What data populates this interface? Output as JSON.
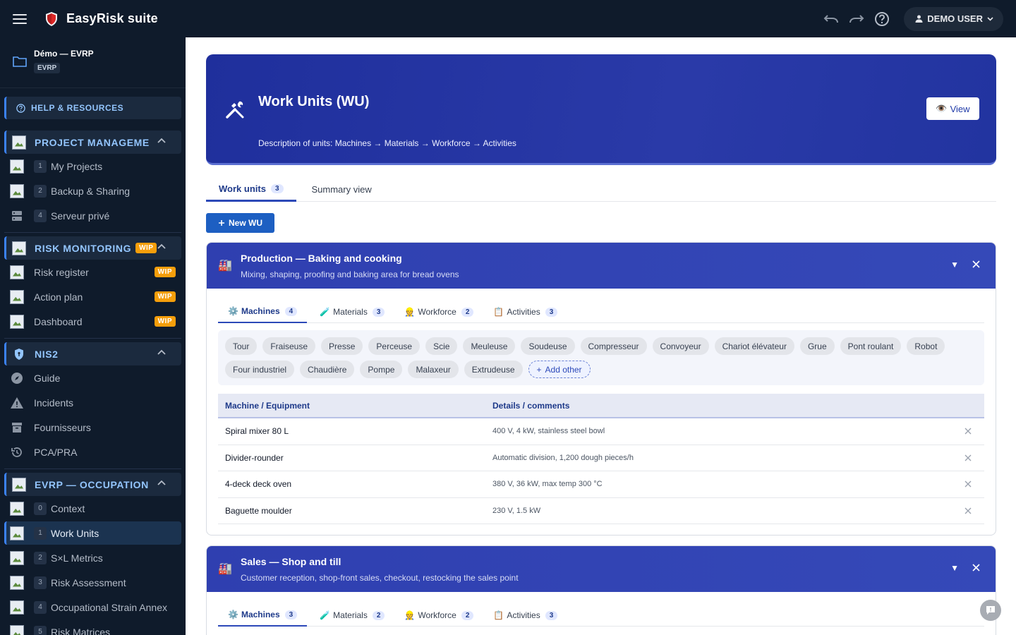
{
  "app": {
    "title": "EasyRisk suite",
    "user_label": "DEMO USER"
  },
  "colors": {
    "topbar": "#0f1b2b",
    "accent": "#2c49b8",
    "wip": "#f59e0b",
    "hero": "#2a3aa8"
  },
  "sidebar": {
    "project": {
      "name": "Démo — EVRP",
      "badge": "EVRP"
    },
    "help_label": "HELP & RESOURCES",
    "sections": [
      {
        "label": "PROJECT MANAGEMEN",
        "items": [
          {
            "num": "1",
            "label": "My Projects"
          },
          {
            "num": "2",
            "label": "Backup & Sharing"
          },
          {
            "num": "4",
            "label": "Serveur privé"
          }
        ]
      },
      {
        "label": "RISK MONITORING",
        "wip": "WIP",
        "items": [
          {
            "label": "Risk register",
            "wip": "WIP"
          },
          {
            "label": "Action plan",
            "wip": "WIP"
          },
          {
            "label": "Dashboard",
            "wip": "WIP"
          }
        ]
      },
      {
        "label": "NIS2",
        "items": [
          {
            "label": "Guide"
          },
          {
            "label": "Incidents"
          },
          {
            "label": "Fournisseurs"
          },
          {
            "label": "PCA/PRA"
          }
        ]
      },
      {
        "label": "EVRP — OCCUPATIONAL",
        "items": [
          {
            "num": "0",
            "label": "Context"
          },
          {
            "num": "1",
            "label": "Work Units"
          },
          {
            "num": "2",
            "label": "S×L Metrics"
          },
          {
            "num": "3",
            "label": "Risk Assessment"
          },
          {
            "num": "4",
            "label": "Occupational Strain Annex"
          },
          {
            "num": "5",
            "label": "Risk Matrices"
          }
        ]
      }
    ]
  },
  "hero": {
    "title": "Work Units (WU)",
    "description": "Description of units: Machines → Materials → Workforce → Activities",
    "view_label": "View"
  },
  "tabs": [
    {
      "label": "Work units",
      "count": "3"
    },
    {
      "label": "Summary view"
    }
  ],
  "new_button": "New WU",
  "cards": [
    {
      "title": "Production — Baking and cooking",
      "subtitle": "Mixing, shaping, proofing and baking area for bread ovens",
      "subtabs": [
        {
          "emoji": "⚙️",
          "label": "Machines",
          "count": "4"
        },
        {
          "emoji": "🧪",
          "label": "Materials",
          "count": "3"
        },
        {
          "emoji": "👷",
          "label": "Workforce",
          "count": "2"
        },
        {
          "emoji": "📋",
          "label": "Activities",
          "count": "3"
        }
      ],
      "chips": [
        "Tour",
        "Fraiseuse",
        "Presse",
        "Perceuse",
        "Scie",
        "Meuleuse",
        "Soudeuse",
        "Compresseur",
        "Convoyeur",
        "Chariot élévateur",
        "Grue",
        "Pont roulant",
        "Robot",
        "Four industriel",
        "Chaudière",
        "Pompe",
        "Malaxeur",
        "Extrudeuse"
      ],
      "add_chip": "Add other",
      "table": {
        "headers": [
          "Machine / Equipment",
          "Details / comments"
        ],
        "rows": [
          [
            "Spiral mixer 80 L",
            "400 V, 4 kW, stainless steel bowl"
          ],
          [
            "Divider-rounder",
            "Automatic division, 1,200 dough pieces/h"
          ],
          [
            "4-deck deck oven",
            "380 V, 36 kW, max temp 300 °C"
          ],
          [
            "Baguette moulder",
            "230 V, 1.5 kW"
          ]
        ]
      }
    },
    {
      "title": "Sales — Shop and till",
      "subtitle": "Customer reception, shop-front sales, checkout, restocking the sales point",
      "subtabs": [
        {
          "emoji": "⚙️",
          "label": "Machines",
          "count": "3"
        },
        {
          "emoji": "🧪",
          "label": "Materials",
          "count": "2"
        },
        {
          "emoji": "👷",
          "label": "Workforce",
          "count": "2"
        },
        {
          "emoji": "📋",
          "label": "Activities",
          "count": "3"
        }
      ]
    }
  ]
}
